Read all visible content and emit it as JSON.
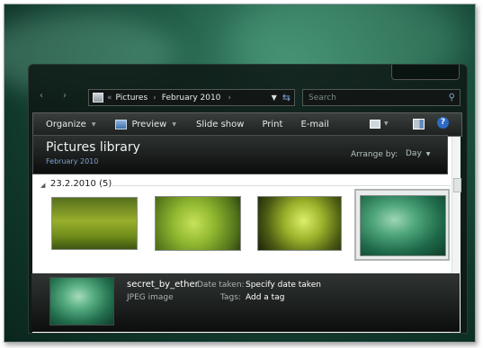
{
  "nav": {
    "address_crumbs": [
      "Pictures",
      "February 2010"
    ],
    "search_placeholder": "Search"
  },
  "toolbar": {
    "organize": "Organize",
    "preview": "Preview",
    "slideshow": "Slide show",
    "print": "Print",
    "email": "E-mail"
  },
  "library": {
    "title": "Pictures library",
    "subtitle": "February 2010",
    "arrange_label": "Arrange by:",
    "arrange_value": "Day"
  },
  "group": {
    "header": "23.2.2010 (5)"
  },
  "details": {
    "filename": "secret_by_ether",
    "filetype": "JPEG image",
    "date_taken_label": "Date taken:",
    "date_taken_value": "Specify date taken",
    "tags_label": "Tags:",
    "tags_value": "Add a tag"
  },
  "colors": {
    "accent": "#2e7a55",
    "selection_border": "#b0b4b2"
  }
}
